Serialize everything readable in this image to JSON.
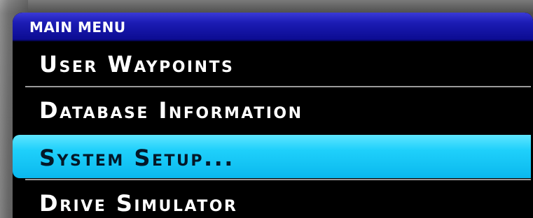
{
  "main_menu": {
    "title": "MAIN MENU",
    "items": [
      {
        "label": "User Waypoints",
        "selected": false
      },
      {
        "label": "Database Information",
        "selected": false
      },
      {
        "label": "System Setup...",
        "selected": true
      },
      {
        "label": "Drive Simulator",
        "selected": false
      }
    ]
  },
  "colors": {
    "title_bar": "#1c1cb4",
    "selection_highlight": "#1fd0fb",
    "screen_background": "#000000",
    "text": "#ffffff"
  }
}
